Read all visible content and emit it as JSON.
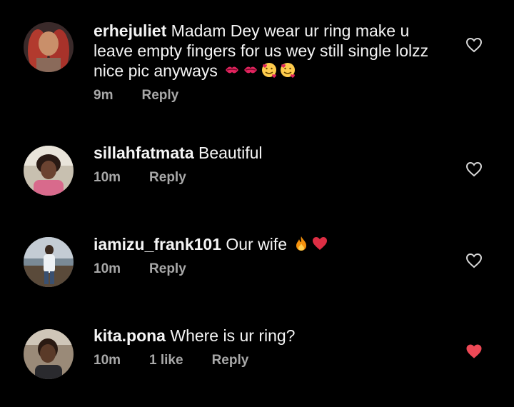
{
  "comments": [
    {
      "username": "erhejuliet",
      "text": "Madam Dey wear ur ring make u leave empty fingers for us wey still single lolzz nice pic anyways",
      "emojis": [
        "kiss-mark-icon",
        "kiss-mark-icon",
        "smiling-face-with-hearts-icon",
        "smiling-face-with-hearts-icon"
      ],
      "time": "9m",
      "reply_label": "Reply",
      "liked": false
    },
    {
      "username": "sillahfatmata",
      "text": "Beautiful",
      "time": "10m",
      "reply_label": "Reply",
      "liked": false
    },
    {
      "username": "iamizu_frank101",
      "text": "Our wife",
      "emojis": [
        "fire-icon",
        "red-heart-icon"
      ],
      "time": "10m",
      "reply_label": "Reply",
      "liked": false
    },
    {
      "username": "kita.pona",
      "text": "Where is ur ring?",
      "time": "10m",
      "likes_label": "1 like",
      "reply_label": "Reply",
      "liked": true
    }
  ],
  "colors": {
    "background": "#000000",
    "text": "#f5f5f5",
    "meta": "#a8a8a8",
    "like_active": "#ed4956"
  }
}
